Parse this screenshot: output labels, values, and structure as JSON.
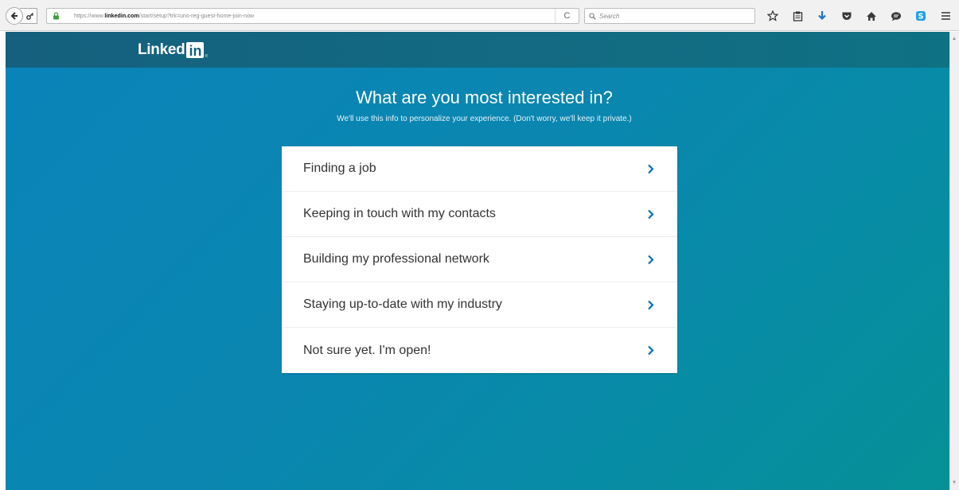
{
  "browser": {
    "url_prefix": "https://www.",
    "url_domain": "linkedin.com",
    "url_path": "/start/setup?trk=uno-reg-guest-home-join-now",
    "reload_glyph": "C",
    "search_placeholder": "Search",
    "toolbar_icons": [
      "bookmark-star-icon",
      "bookmarks-list-icon",
      "download-icon",
      "pocket-icon",
      "home-icon",
      "chat-icon",
      "skype-icon",
      "menu-icon"
    ]
  },
  "header": {
    "logo_text": "Linked",
    "logo_in": "in",
    "logo_reg": "®"
  },
  "main": {
    "title": "What are you most interested in?",
    "subtitle": "We'll use this info to personalize your experience. (Don't worry, we'll keep it private.)",
    "options": [
      {
        "label": "Finding a job"
      },
      {
        "label": "Keeping in touch with my contacts"
      },
      {
        "label": "Building my professional network"
      },
      {
        "label": "Staying up-to-date with my industry"
      },
      {
        "label": "Not sure yet. I'm open!"
      }
    ]
  },
  "colors": {
    "accent": "#0a84b9",
    "chevron": "#0073b1",
    "header_bg": "#14607e"
  }
}
